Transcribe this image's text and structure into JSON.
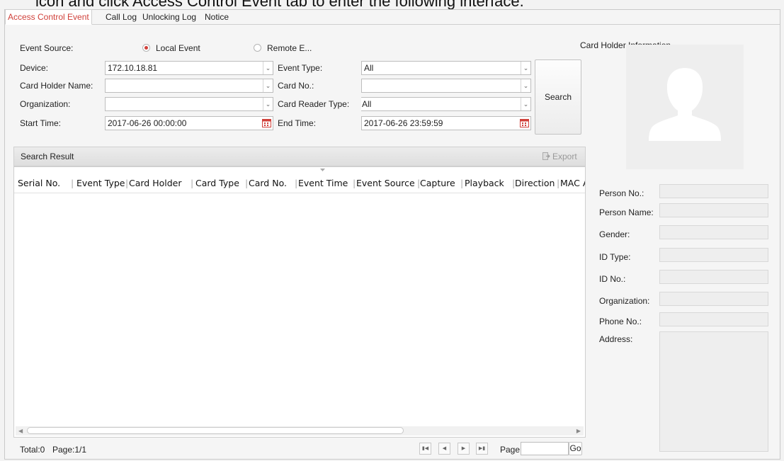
{
  "doc_caption": "icon and click Access Control Event tab to enter the following interface.",
  "tabs": [
    "Access Control Event",
    "Call Log",
    "Unlocking Log",
    "Notice"
  ],
  "filters": {
    "event_source_label": "Event Source:",
    "local_event": "Local Event",
    "remote_event": "Remote E...",
    "device_label": "Device:",
    "device_value": "172.10.18.81",
    "event_type_label": "Event Type:",
    "event_type_value": "All",
    "card_holder_label": "Card Holder Name:",
    "card_holder_value": "",
    "card_no_label": "Card No.:",
    "card_no_value": "",
    "organization_label": "Organization:",
    "organization_value": "",
    "card_reader_type_label": "Card Reader Type:",
    "card_reader_type_value": "All",
    "start_time_label": "Start Time:",
    "start_time_value": "2017-06-26 00:00:00",
    "end_time_label": "End Time:",
    "end_time_value": "2017-06-26 23:59:59",
    "search_button": "Search"
  },
  "result": {
    "title": "Search Result",
    "export_label": "Export",
    "columns": [
      "Serial No.",
      "Event Type",
      "Card Holder",
      "Card Type",
      "Card No.",
      "Event Time",
      "Event Source",
      "Capture",
      "Playback",
      "Direction",
      "MAC A"
    ]
  },
  "footer": {
    "total": "Total:0",
    "page_info": "Page:1/1",
    "page_label": "Page",
    "page_input": "",
    "go_label": "Go"
  },
  "card_holder_info": {
    "title": "Card Holder Information",
    "fields": [
      "Person No.:",
      "Person Name:",
      "Gender:",
      "ID Type:",
      "ID No.:",
      "Organization:",
      "Phone No.:",
      "Address:"
    ]
  },
  "colors": {
    "accent": "#d0403a",
    "panel_bg": "#f5f5f5",
    "photo_bg": "#eeeeee"
  },
  "icons": [
    "calendar-icon",
    "dropdown-arrow-icon",
    "export-icon",
    "avatar-silhouette-icon",
    "first-page-icon",
    "prev-page-icon",
    "next-page-icon",
    "last-page-icon",
    "sort-indicator-icon"
  ]
}
